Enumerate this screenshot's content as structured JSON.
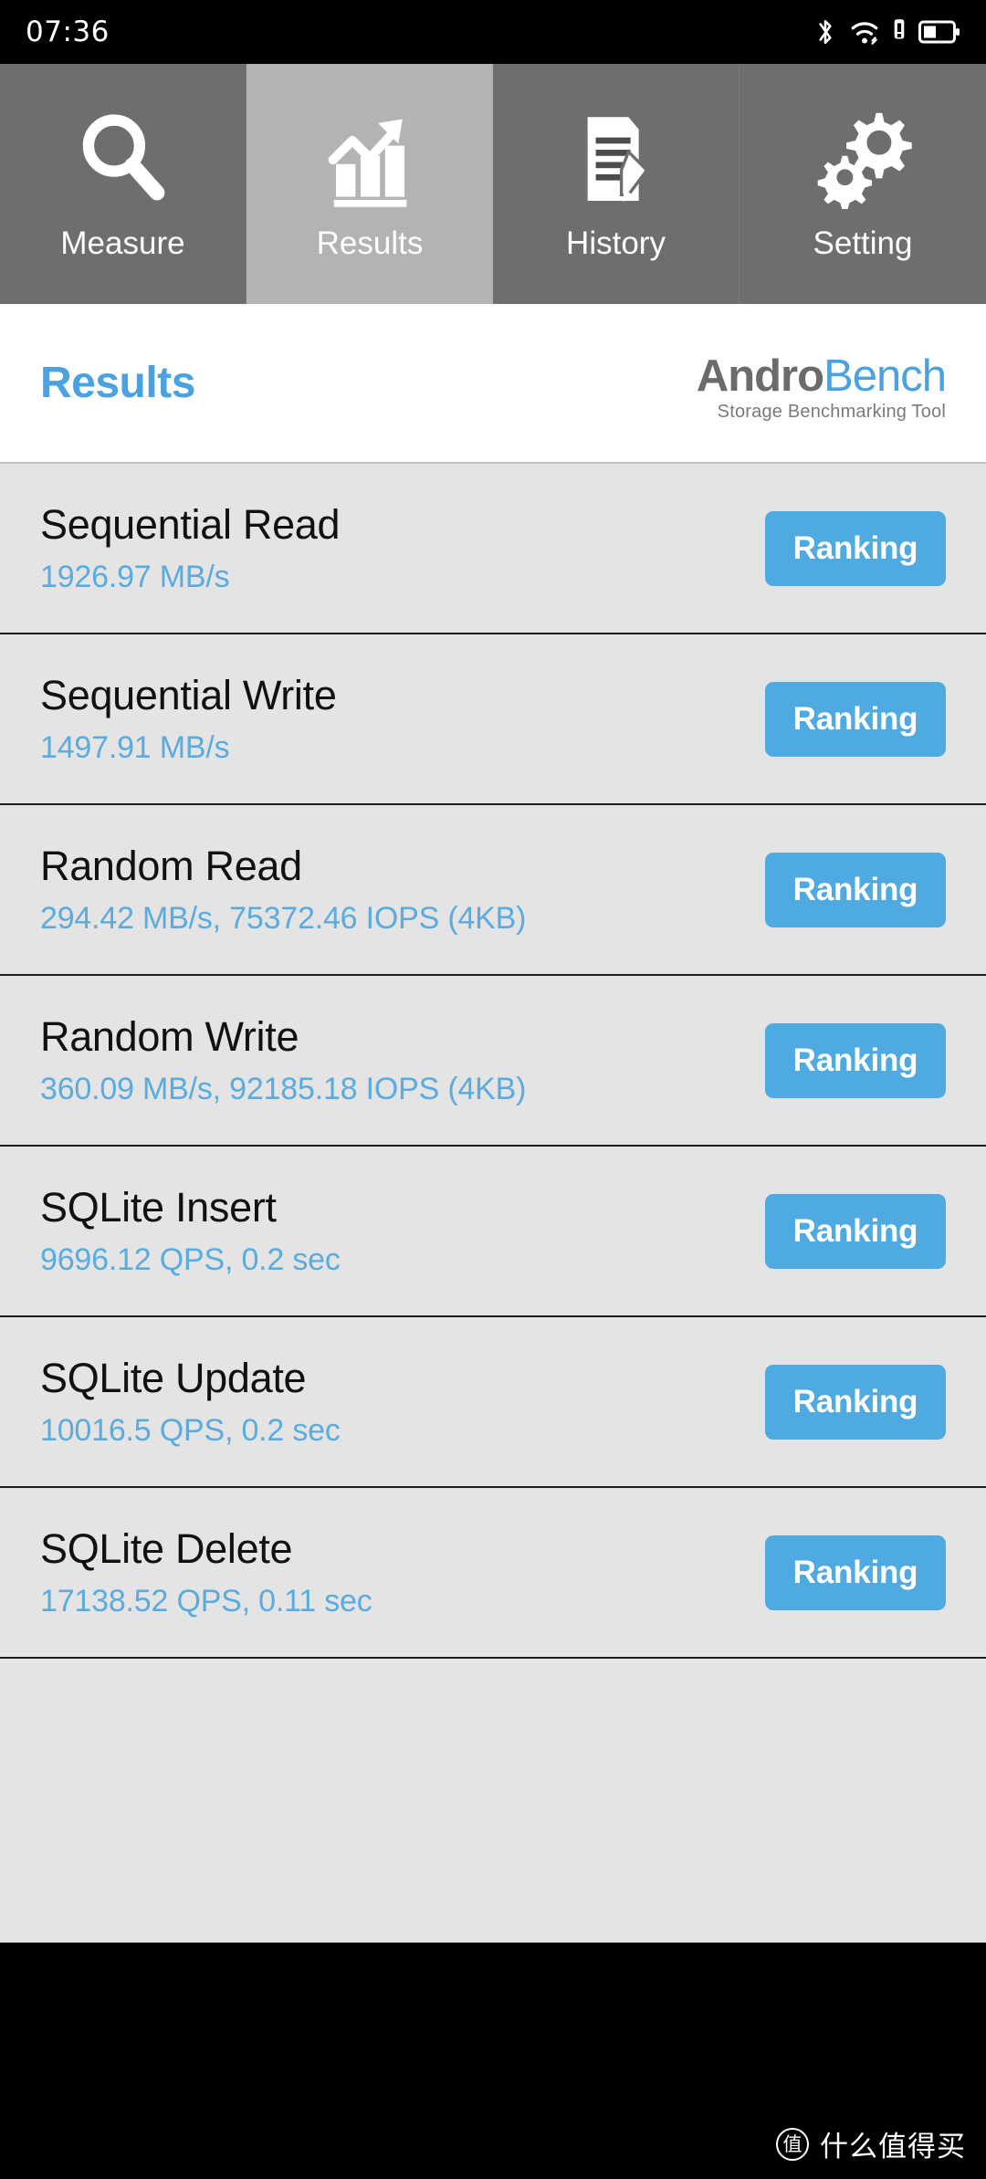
{
  "status_bar": {
    "time": "07:36",
    "icons": [
      "bluetooth-icon",
      "wifi-icon",
      "signal-alert-icon",
      "battery-icon"
    ]
  },
  "tabs": [
    {
      "label": "Measure",
      "icon": "magnifier-icon",
      "selected": false
    },
    {
      "label": "Results",
      "icon": "bar-chart-arrow-icon",
      "selected": true
    },
    {
      "label": "History",
      "icon": "document-pencil-icon",
      "selected": false
    },
    {
      "label": "Setting",
      "icon": "gears-icon",
      "selected": false
    }
  ],
  "header": {
    "page_title": "Results",
    "logo": {
      "name_part1": "Andro",
      "name_part2": "Bench",
      "subtitle": "Storage Benchmarking Tool"
    }
  },
  "results": {
    "button_label": "Ranking",
    "rows": [
      {
        "title": "Sequential Read",
        "value": "1926.97 MB/s"
      },
      {
        "title": "Sequential Write",
        "value": "1497.91 MB/s"
      },
      {
        "title": "Random Read",
        "value": "294.42 MB/s, 75372.46 IOPS (4KB)"
      },
      {
        "title": "Random Write",
        "value": "360.09 MB/s, 92185.18 IOPS (4KB)"
      },
      {
        "title": "SQLite Insert",
        "value": "9696.12 QPS, 0.2 sec"
      },
      {
        "title": "SQLite Update",
        "value": "10016.5 QPS, 0.2 sec"
      },
      {
        "title": "SQLite Delete",
        "value": "17138.52 QPS, 0.11 sec"
      }
    ]
  },
  "watermark": {
    "logo_char": "值",
    "text": "什么值得买"
  },
  "colors": {
    "accent_blue": "#4aa3e0",
    "button_blue": "#4faae2",
    "value_blue": "#5aacdf",
    "tab_inactive": "#6e6e6e",
    "tab_active": "#b3b3b3",
    "list_bg": "#e4e4e4"
  }
}
